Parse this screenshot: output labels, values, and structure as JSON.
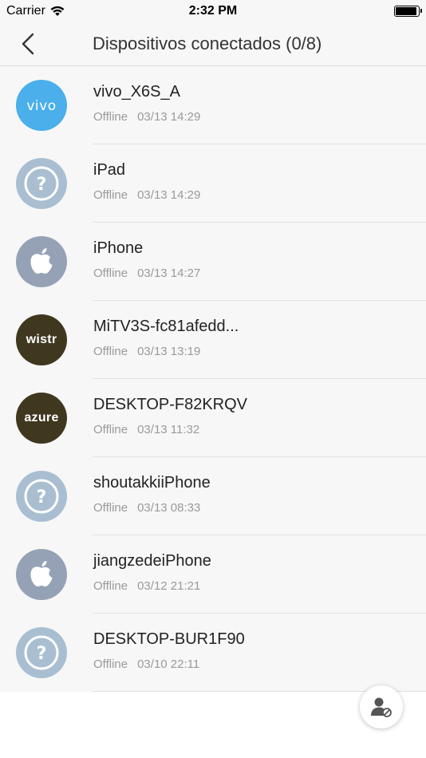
{
  "status_bar": {
    "carrier": "Carrier",
    "time": "2:32 PM",
    "battery_level": 0.95
  },
  "nav": {
    "title": "Dispositivos conectados (0/8)"
  },
  "colors": {
    "vivo": "#4aafea",
    "unknown": "#a9bfd1",
    "apple": "#95a2b6",
    "brand_dark": "#40371f"
  },
  "devices": [
    {
      "name": "vivo_X6S_A",
      "status": "Offline",
      "time": "03/13 14:29",
      "avatar_type": "vivo",
      "avatar_label": "vivo"
    },
    {
      "name": "iPad",
      "status": "Offline",
      "time": "03/13 14:29",
      "avatar_type": "unknown",
      "avatar_label": ""
    },
    {
      "name": "iPhone",
      "status": "Offline",
      "time": "03/13 14:27",
      "avatar_type": "apple",
      "avatar_label": ""
    },
    {
      "name": "MiTV3S-fc81afedd...",
      "status": "Offline",
      "time": "03/13 13:19",
      "avatar_type": "text",
      "avatar_label": "wistr"
    },
    {
      "name": "DESKTOP-F82KRQV",
      "status": "Offline",
      "time": "03/13 11:32",
      "avatar_type": "text",
      "avatar_label": "azure"
    },
    {
      "name": "shoutakkiiPhone",
      "status": "Offline",
      "time": "03/13 08:33",
      "avatar_type": "unknown",
      "avatar_label": ""
    },
    {
      "name": "jiangzedeiPhone",
      "status": "Offline",
      "time": "03/12 21:21",
      "avatar_type": "apple",
      "avatar_label": ""
    },
    {
      "name": "DESKTOP-BUR1F90",
      "status": "Offline",
      "time": "03/10 22:11",
      "avatar_type": "unknown",
      "avatar_label": ""
    }
  ],
  "icons": {
    "back": "chevron-left-icon",
    "fab": "user-blocked-icon",
    "unknown": "question-mark-icon",
    "apple": "apple-logo-icon",
    "vivo": "vivo-logo-icon"
  }
}
